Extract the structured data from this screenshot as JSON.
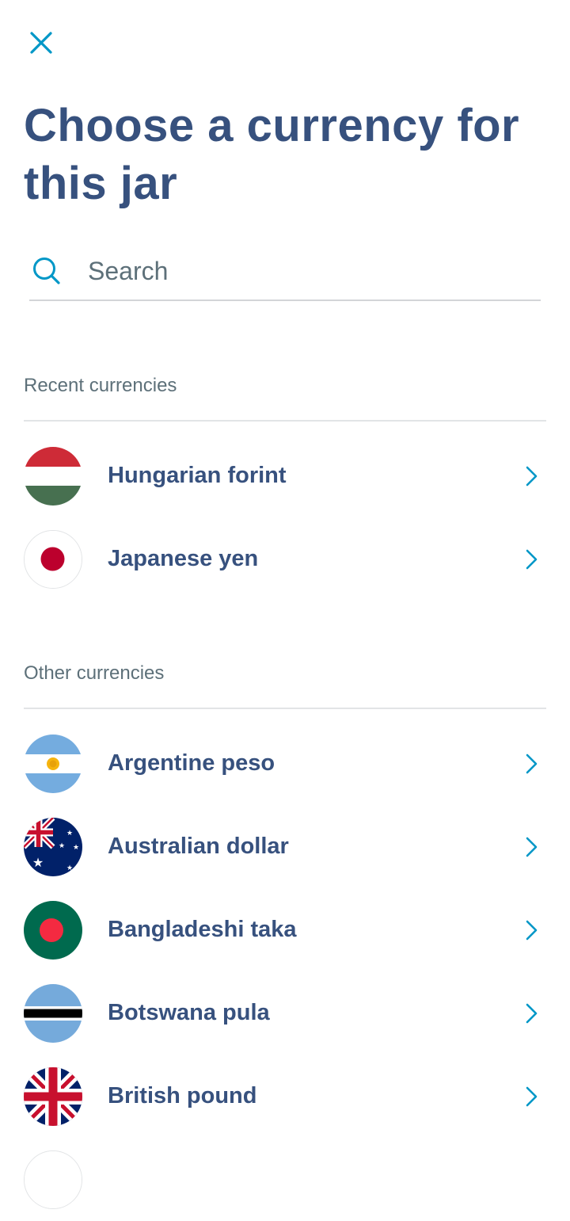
{
  "colors": {
    "accent": "#0097c7",
    "title": "#37517e",
    "muted": "#5d7079",
    "divider": "#e2e4e6"
  },
  "header": {
    "close_icon": "close-icon",
    "title": "Choose a currency for this jar"
  },
  "search": {
    "icon": "search-icon",
    "placeholder": "Search",
    "value": ""
  },
  "recent": {
    "heading": "Recent currencies",
    "items": [
      {
        "label": "Hungarian forint",
        "flag": "hungary-flag-icon"
      },
      {
        "label": "Japanese yen",
        "flag": "japan-flag-icon"
      }
    ]
  },
  "other": {
    "heading": "Other currencies",
    "items": [
      {
        "label": "Argentine peso",
        "flag": "argentina-flag-icon"
      },
      {
        "label": "Australian dollar",
        "flag": "australia-flag-icon"
      },
      {
        "label": "Bangladeshi taka",
        "flag": "bangladesh-flag-icon"
      },
      {
        "label": "Botswana pula",
        "flag": "botswana-flag-icon"
      },
      {
        "label": "British pound",
        "flag": "uk-flag-icon"
      }
    ]
  }
}
